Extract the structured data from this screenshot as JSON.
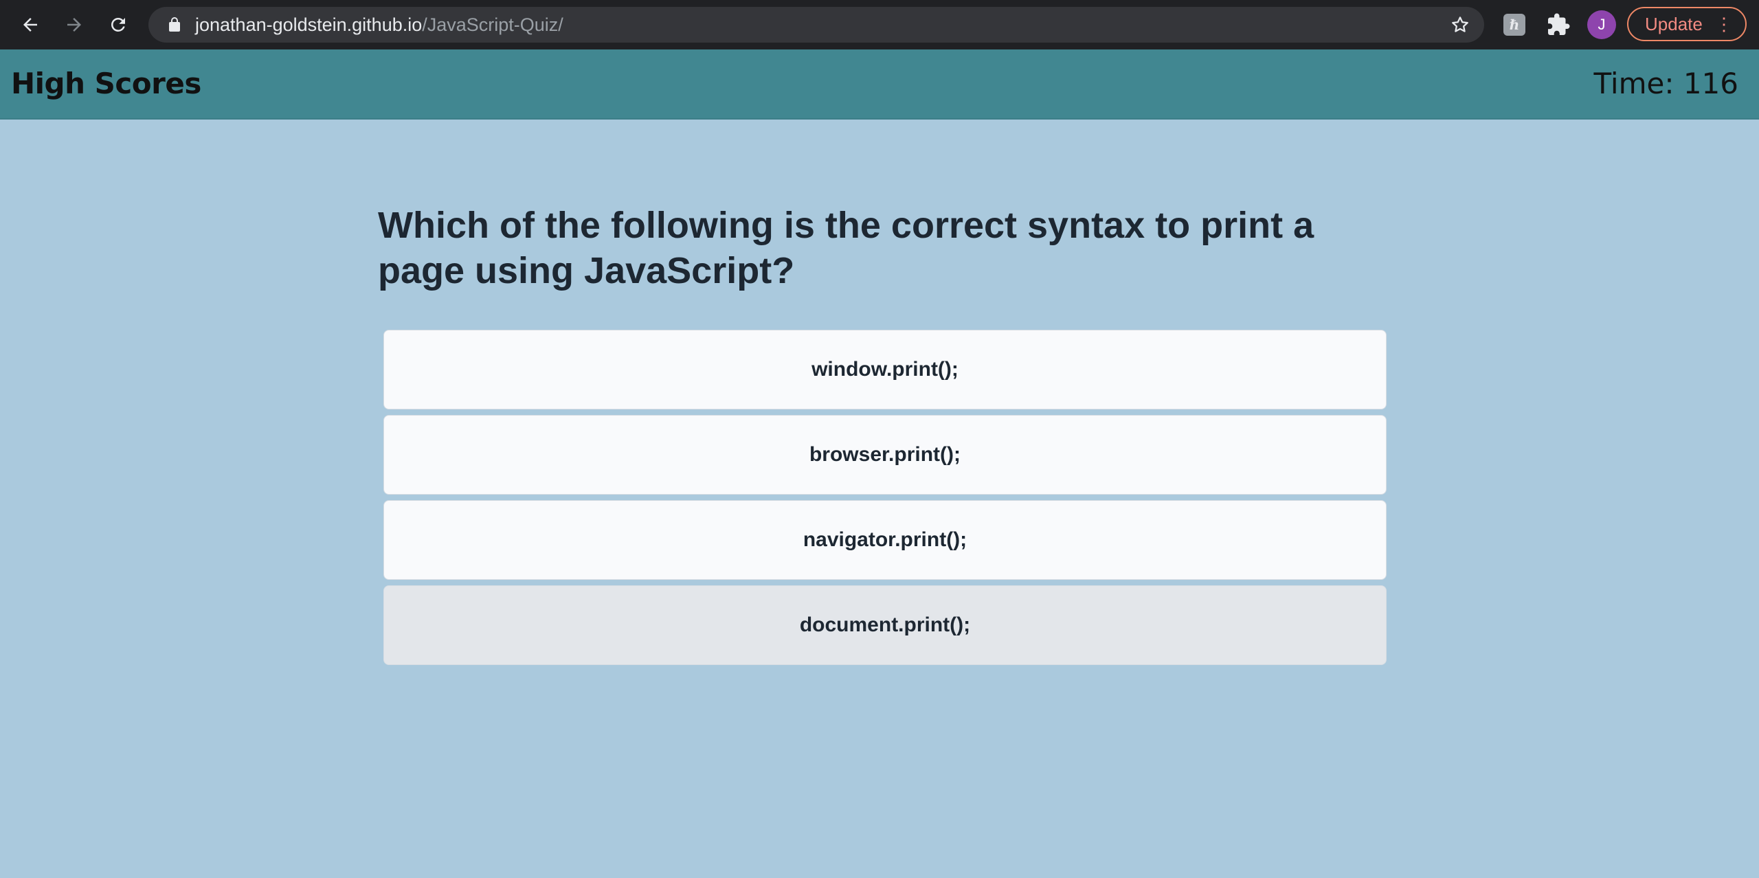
{
  "browser": {
    "url_host": "jonathan-goldstein.github.io",
    "url_path": "/JavaScript-Quiz/",
    "avatar_letter": "J",
    "update_label": "Update",
    "extension_letter": "ℏ"
  },
  "header": {
    "high_scores_label": "High Scores",
    "timer_text": "Time: 116"
  },
  "quiz": {
    "question": "Which of the following is the correct syntax to print a page using JavaScript?",
    "answers": [
      {
        "label": "window.print();"
      },
      {
        "label": "browser.print();"
      },
      {
        "label": "navigator.print();"
      },
      {
        "label": "document.print();",
        "hovered": true
      }
    ]
  },
  "colors": {
    "page_bg": "#aac9dd",
    "header_bg": "#418791",
    "answer_bg": "#f9fafc",
    "answer_hover_bg": "#e3e6ea"
  }
}
